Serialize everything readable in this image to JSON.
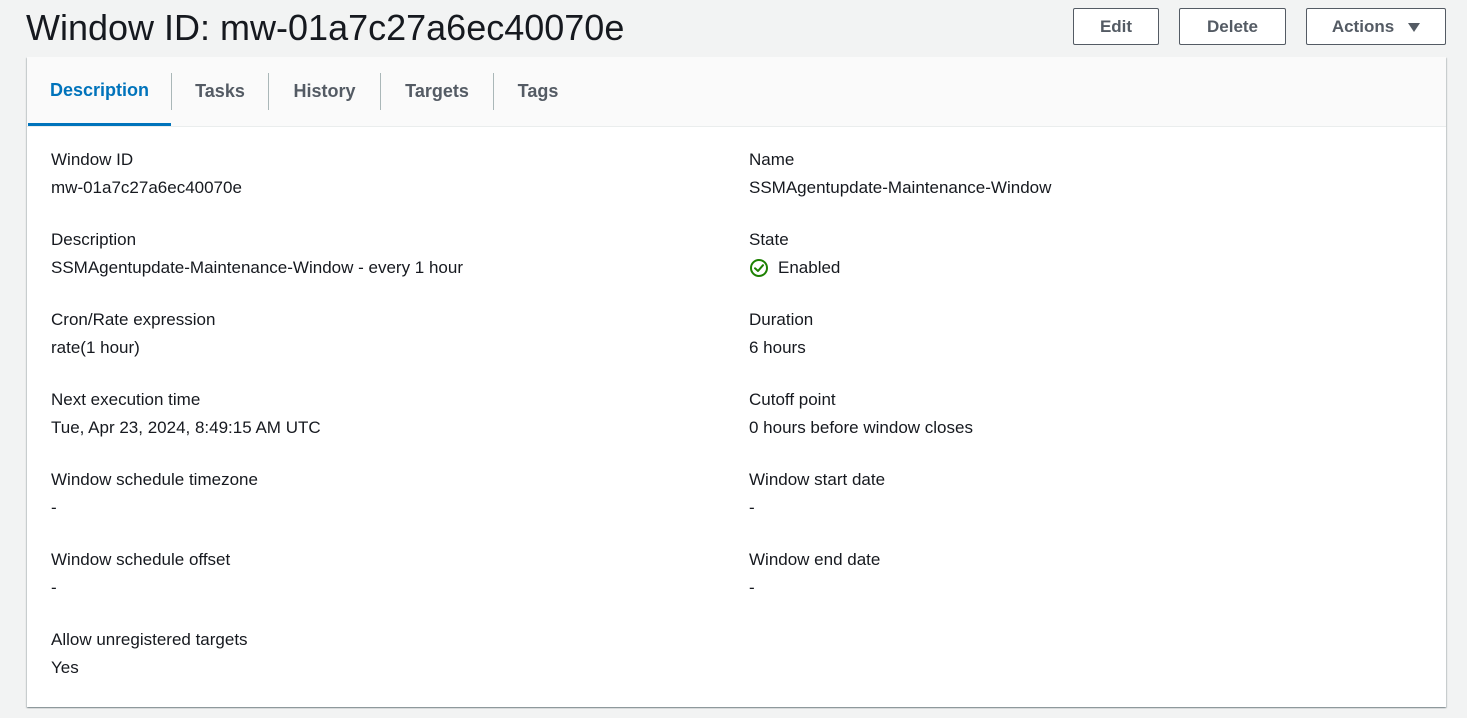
{
  "header": {
    "title": "Window ID: mw-01a7c27a6ec40070e",
    "edit_label": "Edit",
    "delete_label": "Delete",
    "actions_label": "Actions"
  },
  "tabs": [
    {
      "label": "Description",
      "active": true
    },
    {
      "label": "Tasks",
      "active": false
    },
    {
      "label": "History",
      "active": false
    },
    {
      "label": "Targets",
      "active": false
    },
    {
      "label": "Tags",
      "active": false
    }
  ],
  "details": {
    "window_id": {
      "label": "Window ID",
      "value": "mw-01a7c27a6ec40070e"
    },
    "name": {
      "label": "Name",
      "value": "SSMAgentupdate-Maintenance-Window"
    },
    "description": {
      "label": "Description",
      "value": "SSMAgentupdate-Maintenance-Window - every 1 hour"
    },
    "state": {
      "label": "State",
      "value": "Enabled",
      "icon": "check-circle-icon",
      "color": "#1d8102"
    },
    "cron": {
      "label": "Cron/Rate expression",
      "value": "rate(1 hour)"
    },
    "duration": {
      "label": "Duration",
      "value": "6 hours"
    },
    "next_execution": {
      "label": "Next execution time",
      "value": "Tue, Apr 23, 2024, 8:49:15 AM UTC"
    },
    "cutoff": {
      "label": "Cutoff point",
      "value": "0 hours before window closes"
    },
    "timezone": {
      "label": "Window schedule timezone",
      "value": "-"
    },
    "start_date": {
      "label": "Window start date",
      "value": "-"
    },
    "offset": {
      "label": "Window schedule offset",
      "value": "-"
    },
    "end_date": {
      "label": "Window end date",
      "value": "-"
    },
    "unregistered": {
      "label": "Allow unregistered targets",
      "value": "Yes"
    }
  },
  "colors": {
    "accent": "#0073bb",
    "success": "#1d8102",
    "button_border": "#545b64"
  }
}
